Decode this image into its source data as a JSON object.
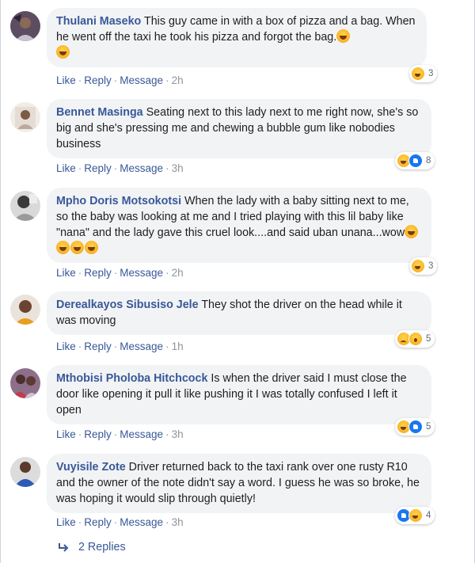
{
  "comments": [
    {
      "author": "Thulani Maseko",
      "text": "This guy came in with a box of pizza and a bag. When he went off the taxi he took his pizza and forgot the bag.",
      "emojis": [
        "laughing-tears",
        "laughing-tears"
      ],
      "actions": {
        "like": "Like",
        "reply": "Reply",
        "message": "Message",
        "time": "2h"
      },
      "reactions": {
        "types": [
          "haha"
        ],
        "count": "3"
      }
    },
    {
      "author": "Bennet Masinga",
      "text": "Seating next to this lady next to me right now, she's so big and she's pressing me and chewing a bubble gum like nobodies business",
      "emojis": [],
      "actions": {
        "like": "Like",
        "reply": "Reply",
        "message": "Message",
        "time": "3h"
      },
      "reactions": {
        "types": [
          "haha",
          "like"
        ],
        "count": "8"
      }
    },
    {
      "author": "Mpho Doris Motsokotsi",
      "text": "When the lady with a baby sitting next to me, so the baby was looking at me and I tried playing with this lil baby like \"nana\" and the lady gave this cruel look....and said uban unana...wow",
      "emojis": [
        "laughing-tears",
        "laughing-tears",
        "laughing-tears",
        "laughing-tears"
      ],
      "actions": {
        "like": "Like",
        "reply": "Reply",
        "message": "Message",
        "time": "2h"
      },
      "reactions": {
        "types": [
          "haha"
        ],
        "count": "3"
      }
    },
    {
      "author": "Derealkayos Sibusiso Jele",
      "text": "They shot the driver on the head while it was moving",
      "emojis": [],
      "actions": {
        "like": "Like",
        "reply": "Reply",
        "message": "Message",
        "time": "1h"
      },
      "reactions": {
        "types": [
          "sad",
          "wow"
        ],
        "count": "5"
      }
    },
    {
      "author": "Mthobisi Pholoba Hitchcock",
      "text": "Is when the driver said I must close the door like opening it pull it like pushing it I was totally confused I left it open",
      "emojis": [],
      "actions": {
        "like": "Like",
        "reply": "Reply",
        "message": "Message",
        "time": "3h"
      },
      "reactions": {
        "types": [
          "haha",
          "like"
        ],
        "count": "5"
      }
    },
    {
      "author": "Vuyisile Zote",
      "text": "Driver returned back to the taxi rank over one rusty R10 and the owner of the note didn't say a word. I guess he was so broke, he was hoping it would slip through quietly!",
      "emojis": [],
      "actions": {
        "like": "Like",
        "reply": "Reply",
        "message": "Message",
        "time": "3h"
      },
      "reactions": {
        "types": [
          "like",
          "haha"
        ],
        "count": "4"
      }
    }
  ],
  "replies_link": "2 Replies",
  "colors": {
    "author": "#385898",
    "bubble": "#f2f3f5",
    "meta": "#90949c",
    "like_blue": "#1877f2",
    "haha_yellow": "#f7b125"
  }
}
